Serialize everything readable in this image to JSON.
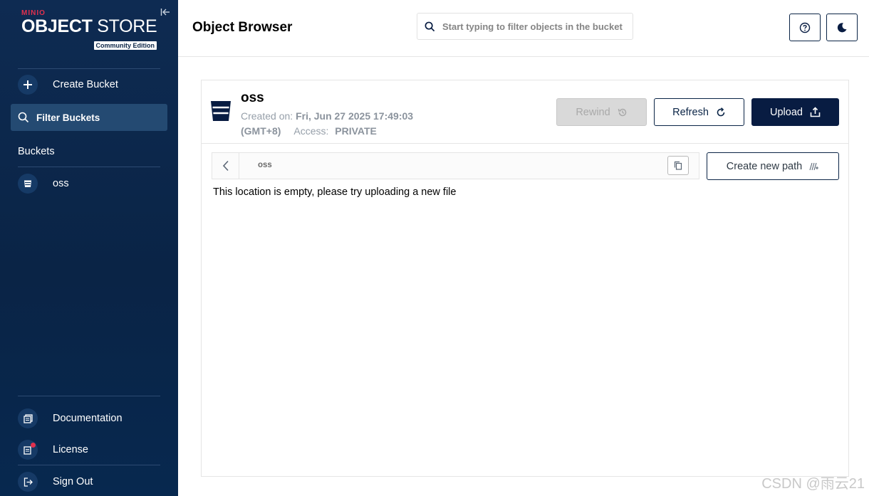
{
  "sidebar": {
    "logo": {
      "brand": "MINIO",
      "title_bold": "OBJECT",
      "title_light": " STORE",
      "edition": "Community Edition"
    },
    "create_bucket": "Create Bucket",
    "filter_buckets": "Filter Buckets",
    "buckets_title": "Buckets",
    "buckets": [
      {
        "name": "oss"
      }
    ],
    "documentation": "Documentation",
    "license": "License",
    "sign_out": "Sign Out"
  },
  "header": {
    "title": "Object Browser",
    "search_placeholder": "Start typing to filter objects in the bucket"
  },
  "bucket": {
    "name": "oss",
    "created_label": "Created on:",
    "created_value": "Fri, Jun 27 2025 17:49:03",
    "timezone": "(GMT+8)",
    "access_label": "Access:",
    "access_value": "PRIVATE"
  },
  "actions": {
    "rewind": "Rewind",
    "refresh": "Refresh",
    "upload": "Upload"
  },
  "browser": {
    "path": "oss",
    "create_new_path": "Create new path",
    "empty_message": "This location is empty, please try uploading a new file"
  },
  "watermark": "CSDN @雨云21",
  "colors": {
    "sidebar_bg": "#0a2446",
    "primary": "#081c42",
    "accent_red": "#e0304e"
  }
}
